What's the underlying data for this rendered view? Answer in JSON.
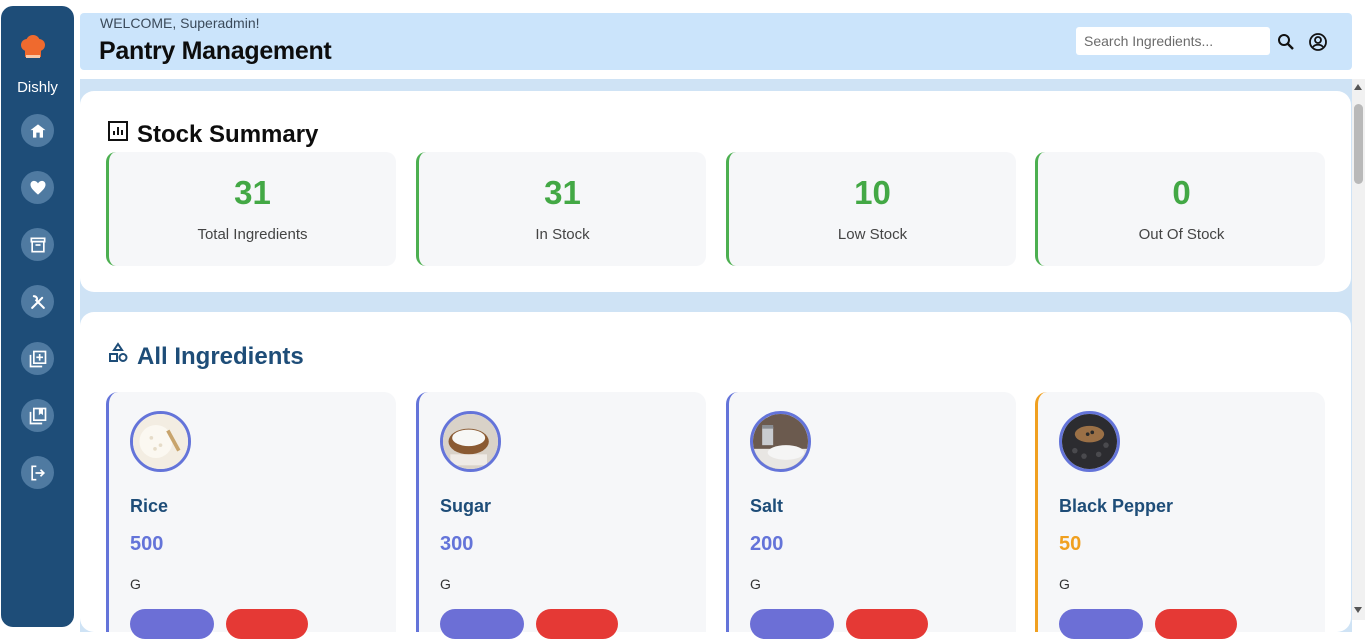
{
  "brand": {
    "name": "Dishly",
    "logo_icon": "chef-hat-icon"
  },
  "sidebar": {
    "items": [
      {
        "icon": "home-icon"
      },
      {
        "icon": "heart-icon"
      },
      {
        "icon": "archive-icon"
      },
      {
        "icon": "utensils-icon"
      },
      {
        "icon": "add-box-icon"
      },
      {
        "icon": "library-icon"
      },
      {
        "icon": "logout-icon"
      }
    ]
  },
  "header": {
    "welcome": "WELCOME, Superadmin!",
    "title": "Pantry Management",
    "search_placeholder": "Search Ingredients..."
  },
  "stock_summary": {
    "title": "Stock Summary",
    "stats": [
      {
        "value": "31",
        "label": "Total Ingredients"
      },
      {
        "value": "31",
        "label": "In Stock"
      },
      {
        "value": "10",
        "label": "Low Stock"
      },
      {
        "value": "0",
        "label": "Out Of Stock"
      }
    ]
  },
  "ingredients": {
    "title": "All Ingredients",
    "items": [
      {
        "name": "Rice",
        "quantity": "500",
        "unit": "G",
        "status": "ok"
      },
      {
        "name": "Sugar",
        "quantity": "300",
        "unit": "G",
        "status": "ok"
      },
      {
        "name": "Salt",
        "quantity": "200",
        "unit": "G",
        "status": "ok"
      },
      {
        "name": "Black Pepper",
        "quantity": "50",
        "unit": "G",
        "status": "low"
      }
    ]
  },
  "colors": {
    "sidebar": "#1e4d78",
    "header": "#cbe4fb",
    "stat_green": "#43a845",
    "accent_blue": "#6474d9",
    "warning": "#f0a020",
    "danger": "#e53935"
  }
}
